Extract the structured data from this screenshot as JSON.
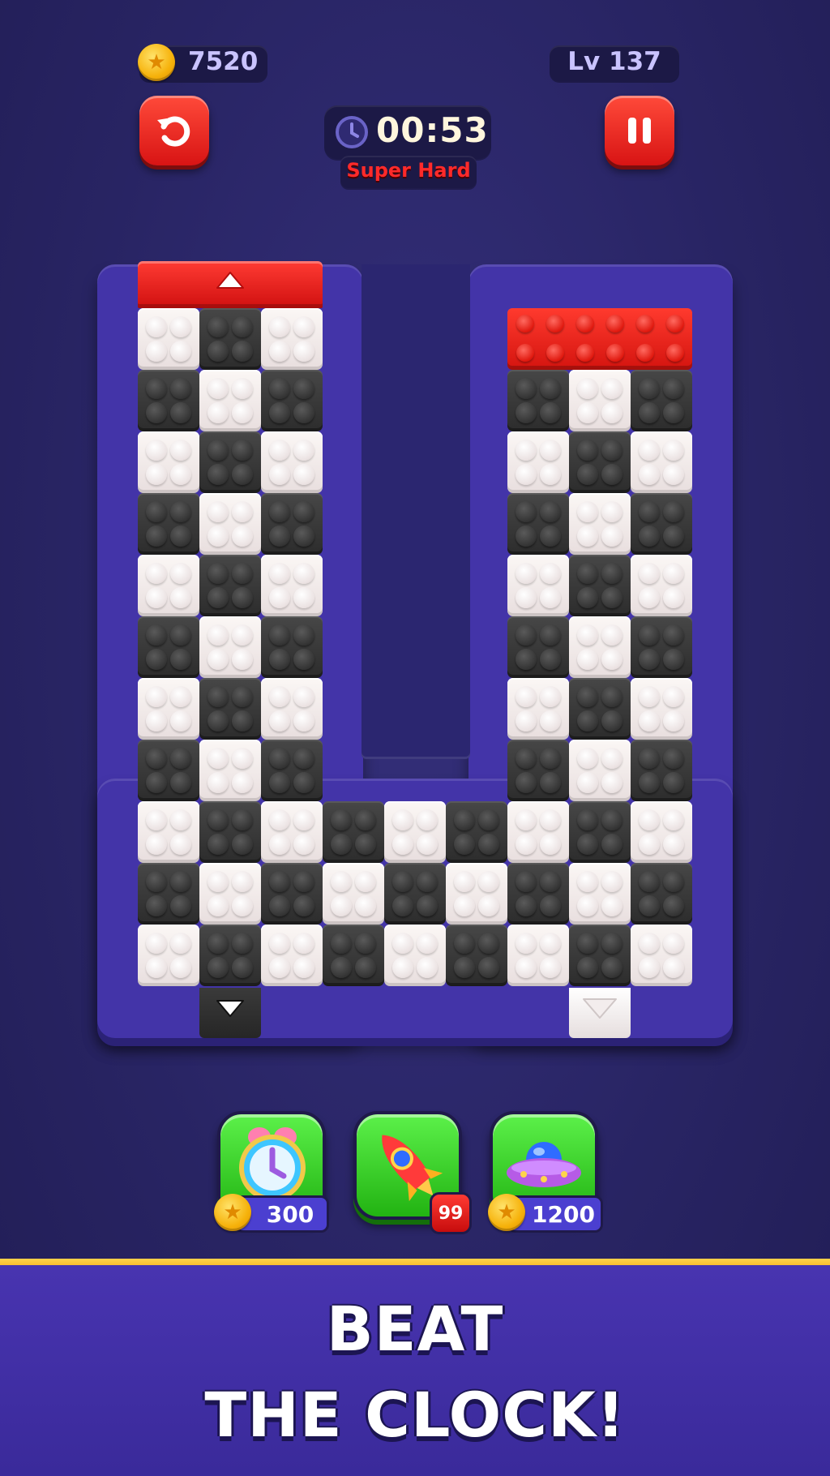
{
  "hud": {
    "coins": "7520",
    "level": "Lv 137",
    "timer": "00:53",
    "difficulty": "Super Hard"
  },
  "board": {
    "left_column": {
      "gate_color": "red",
      "rows": [
        "WBW",
        "BWB",
        "WBW",
        "BWB",
        "WBW",
        "BWB",
        "WBW",
        "BWB",
        "WBW",
        "BWB",
        "WBW"
      ]
    },
    "bottom_row_middle": [
      "BWB",
      "WBW",
      "BWB"
    ],
    "right_column": {
      "red_piece": true,
      "rows": [
        "BWB",
        "WBW",
        "BWB",
        "WBW",
        "BWB",
        "WBW",
        "BWB",
        "WBW",
        "BWB",
        "WBW"
      ]
    },
    "exits": [
      "black",
      "white"
    ]
  },
  "boosters": [
    {
      "icon": "alarm-clock-icon",
      "price": "300"
    },
    {
      "icon": "rocket-icon",
      "count": "99"
    },
    {
      "icon": "ufo-icon",
      "price": "1200"
    }
  ],
  "banner": {
    "line1": "BEAT",
    "line2": "THE CLOCK!"
  },
  "colors": {
    "background": "#282463",
    "board_frame": "#4334a8",
    "red": "#e01a14",
    "green": "#3cd62a",
    "gold": "#f6b10a"
  }
}
